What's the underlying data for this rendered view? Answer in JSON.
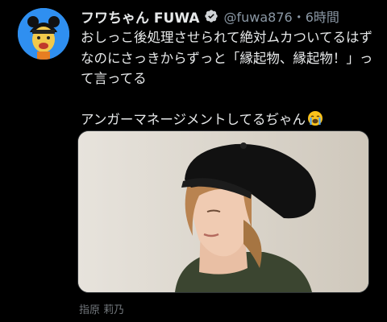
{
  "tweet": {
    "display_name": "フワちゃん FUWA",
    "verified_icon": "verified-badge-icon",
    "handle_time": "@fuwa876・6時間",
    "text": "おしっこ後処理させられて絶対ムカついてるはずなのにさっきからずっと「縁起物、縁起物！」って言ってる\n\nアンガーマネージメントしてるぢゃん",
    "emoji_icon": "loudly-crying-face-icon"
  },
  "media": {
    "subject": "woman-in-black-cap-photo",
    "caption": "指原 莉乃"
  },
  "colors": {
    "background": "#000000",
    "text": "#e7e9ea",
    "secondary": "#8b98a5",
    "verified": "#1d9bf0",
    "avatar_bg": "#2f8ff0"
  }
}
